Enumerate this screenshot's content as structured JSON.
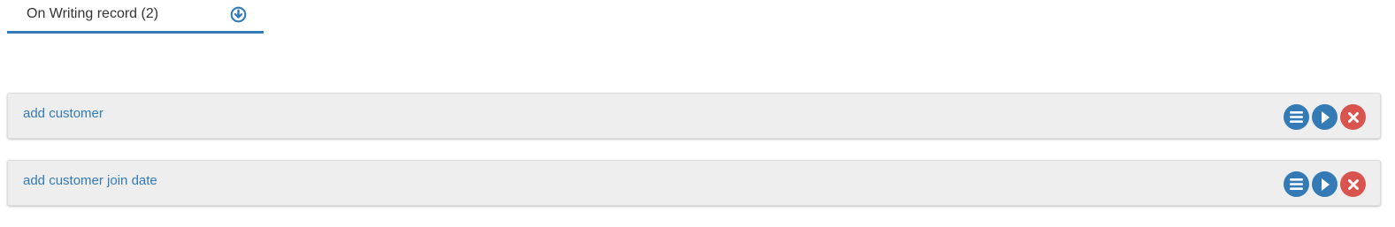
{
  "tab": {
    "label": "On Writing record (2)",
    "download_icon": "circle-arrow-down-icon"
  },
  "colors": {
    "primary": "#337ab7",
    "danger": "#d9534f",
    "item_bg": "#eeeeee",
    "text": "#333333"
  },
  "records": [
    {
      "label": "add customer",
      "actions": [
        "list-icon",
        "play-icon",
        "close-icon"
      ]
    },
    {
      "label": "add customer join date",
      "actions": [
        "list-icon",
        "play-icon",
        "close-icon"
      ]
    }
  ]
}
